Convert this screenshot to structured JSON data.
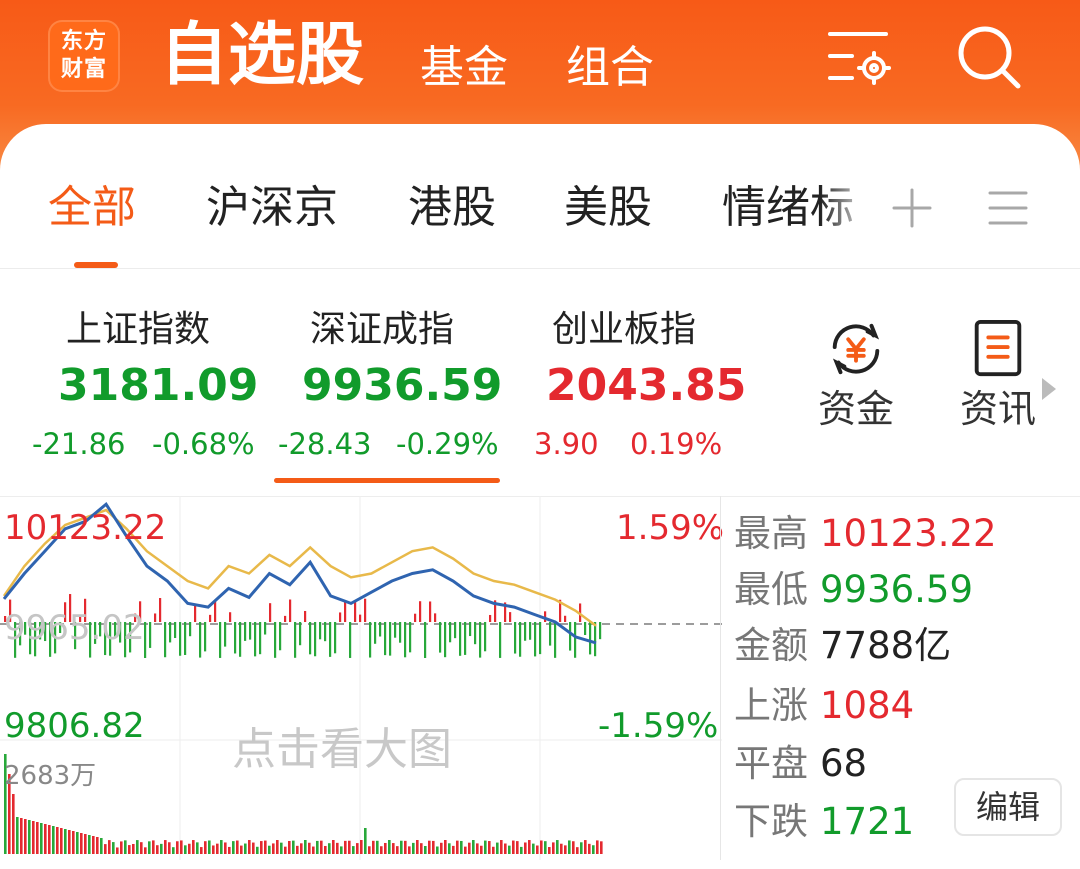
{
  "header": {
    "logo_line1": "东方",
    "logo_line2": "财富",
    "tabs": [
      {
        "label": "自选股",
        "active": true
      },
      {
        "label": "基金"
      },
      {
        "label": "组合"
      }
    ],
    "accent_color": "#f75a17"
  },
  "categories": {
    "items": [
      {
        "label": "全部",
        "active": true
      },
      {
        "label": "沪深京"
      },
      {
        "label": "港股"
      },
      {
        "label": "美股"
      },
      {
        "label": "情绪标"
      }
    ],
    "add_icon": "plus-icon",
    "menu_icon": "menu-icon"
  },
  "indices": [
    {
      "name": "上证指数",
      "value": "3181.09",
      "change": "-21.86",
      "pct": "-0.68%",
      "trend": "down"
    },
    {
      "name": "深证成指",
      "value": "9936.59",
      "change": "-28.43",
      "pct": "-0.29%",
      "trend": "down",
      "selected": true
    },
    {
      "name": "创业板指",
      "value": "2043.85",
      "change": "3.90",
      "pct": "0.19%",
      "trend": "up"
    }
  ],
  "shortcuts": [
    {
      "label": "资金",
      "icon": "yuan-cycle-icon"
    },
    {
      "label": "资讯",
      "icon": "document-icon"
    }
  ],
  "chart": {
    "high_label": "10123.22",
    "prev_close_label": "9965.02",
    "low_label": "9806.82",
    "pct_up": "1.59%",
    "pct_down": "-1.59%",
    "volume_label": "2683万",
    "hint": "点击看大图"
  },
  "stats": [
    {
      "key": "最高",
      "value": "10123.22",
      "color": "red"
    },
    {
      "key": "最低",
      "value": "9936.59",
      "color": "green"
    },
    {
      "key": "金额",
      "value": "7788亿",
      "color": "black"
    },
    {
      "key": "上涨",
      "value": "1084",
      "color": "red"
    },
    {
      "key": "平盘",
      "value": "68",
      "color": "black"
    },
    {
      "key": "下跌",
      "value": "1721",
      "color": "green"
    }
  ],
  "edit_label": "编辑",
  "chart_data": {
    "type": "line",
    "series": [
      {
        "name": "",
        "color": "#2f64b0",
        "values": [
          9996,
          10030,
          10060,
          10090,
          10100,
          10123,
          10080,
          10040,
          10020,
          9990,
          9985,
          10010,
          9998,
          10030,
          10015,
          10045,
          10000,
          9990,
          10005,
          10020,
          10030,
          10035,
          10020,
          10000,
          9990,
          9985,
          9975,
          9965,
          9945,
          9937
        ]
      },
      {
        "name": "",
        "color": "#e8b94a",
        "values": [
          10000,
          10040,
          10070,
          10095,
          10105,
          10115,
          10090,
          10060,
          10040,
          10020,
          10010,
          10040,
          10030,
          10055,
          10040,
          10065,
          10040,
          10025,
          10030,
          10045,
          10060,
          10065,
          10050,
          10030,
          10020,
          10015,
          10005,
          9995,
          9980,
          9960
        ]
      }
    ],
    "ylim": [
      9806.82,
      10123.22
    ],
    "baseline": 9965.02
  }
}
